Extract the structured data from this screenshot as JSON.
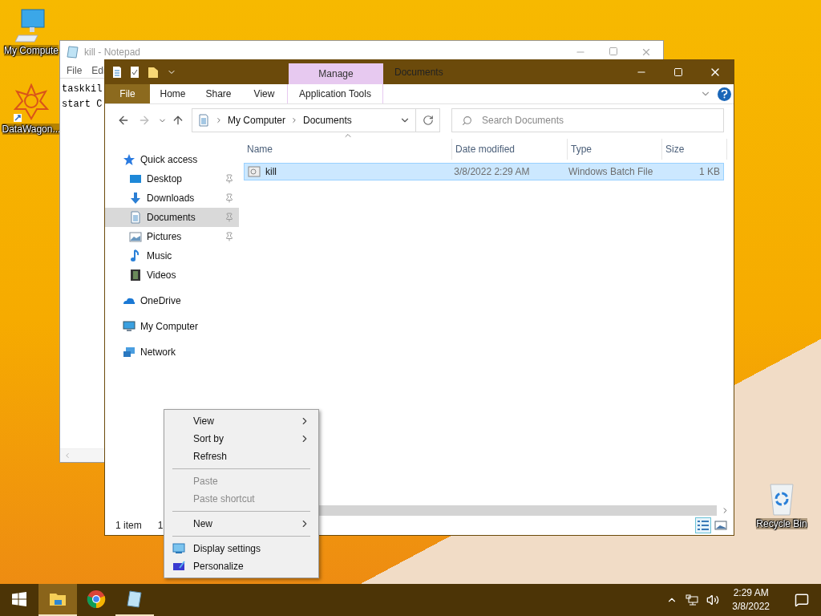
{
  "desktop_icons": [
    {
      "label": "My Compute",
      "kind": "computer"
    },
    {
      "label": "DataWagon...",
      "kind": "app"
    },
    {
      "label": "Recycle Bin",
      "kind": "recycle"
    }
  ],
  "notepad": {
    "title": "kill - Notepad",
    "menu": [
      "File",
      "Edi"
    ],
    "lines": [
      "taskkil",
      "start C"
    ]
  },
  "explorer": {
    "title": "Documents",
    "context_tab": "Manage",
    "ribbon_tabs": [
      {
        "label": "File",
        "kind": "file"
      },
      {
        "label": "Home",
        "kind": "tab"
      },
      {
        "label": "Share",
        "kind": "tab"
      },
      {
        "label": "View",
        "kind": "tab"
      },
      {
        "label": "Application Tools",
        "kind": "context"
      }
    ],
    "address": {
      "path": [
        "My Computer",
        "Documents"
      ]
    },
    "search": {
      "placeholder": "Search Documents"
    },
    "nav": [
      {
        "label": "Quick access",
        "kind": "star",
        "selected": false,
        "children": [
          {
            "label": "Desktop",
            "kind": "desktop",
            "pinned": true,
            "selected": false
          },
          {
            "label": "Downloads",
            "kind": "download",
            "pinned": true,
            "selected": false
          },
          {
            "label": "Documents",
            "kind": "document",
            "pinned": true,
            "selected": true
          },
          {
            "label": "Pictures",
            "kind": "pictures",
            "pinned": true,
            "selected": false
          },
          {
            "label": "Music",
            "kind": "music",
            "pinned": false,
            "selected": false
          },
          {
            "label": "Videos",
            "kind": "videos",
            "pinned": false,
            "selected": false
          }
        ]
      },
      {
        "label": "OneDrive",
        "kind": "cloud",
        "selected": false
      },
      {
        "label": "My Computer",
        "kind": "computer",
        "selected": false
      },
      {
        "label": "Network",
        "kind": "network",
        "selected": false
      }
    ],
    "columns": [
      "Name",
      "Date modified",
      "Type",
      "Size"
    ],
    "files": [
      {
        "name": "kill",
        "date": "3/8/2022 2:29 AM",
        "type": "Windows Batch File",
        "size": "1 KB",
        "selected": true
      }
    ],
    "status": {
      "count": "1 item",
      "selection": "1"
    },
    "view_buttons": [
      {
        "kind": "details",
        "selected": true
      },
      {
        "kind": "large_icons",
        "selected": false
      }
    ]
  },
  "context_menu": [
    {
      "kind": "item",
      "label": "View",
      "submenu": true,
      "disabled": false
    },
    {
      "kind": "item",
      "label": "Sort by",
      "submenu": true,
      "disabled": false
    },
    {
      "kind": "item",
      "label": "Refresh",
      "submenu": false,
      "disabled": false
    },
    {
      "kind": "separator"
    },
    {
      "kind": "item",
      "label": "Paste",
      "submenu": false,
      "disabled": true
    },
    {
      "kind": "item",
      "label": "Paste shortcut",
      "submenu": false,
      "disabled": true
    },
    {
      "kind": "separator"
    },
    {
      "kind": "item",
      "label": "New",
      "submenu": true,
      "disabled": false
    },
    {
      "kind": "separator"
    },
    {
      "kind": "display",
      "label": "Display settings",
      "submenu": false,
      "disabled": false
    },
    {
      "kind": "personalize",
      "label": "Personalize",
      "submenu": false,
      "disabled": false
    }
  ],
  "taskbar": {
    "apps": [
      {
        "kind": "explorer",
        "active": true,
        "running": true
      },
      {
        "kind": "chrome",
        "active": false,
        "running": false
      },
      {
        "kind": "notepad",
        "active": false,
        "running": true
      }
    ],
    "time": "2:29 AM",
    "date": "3/8/2022"
  }
}
